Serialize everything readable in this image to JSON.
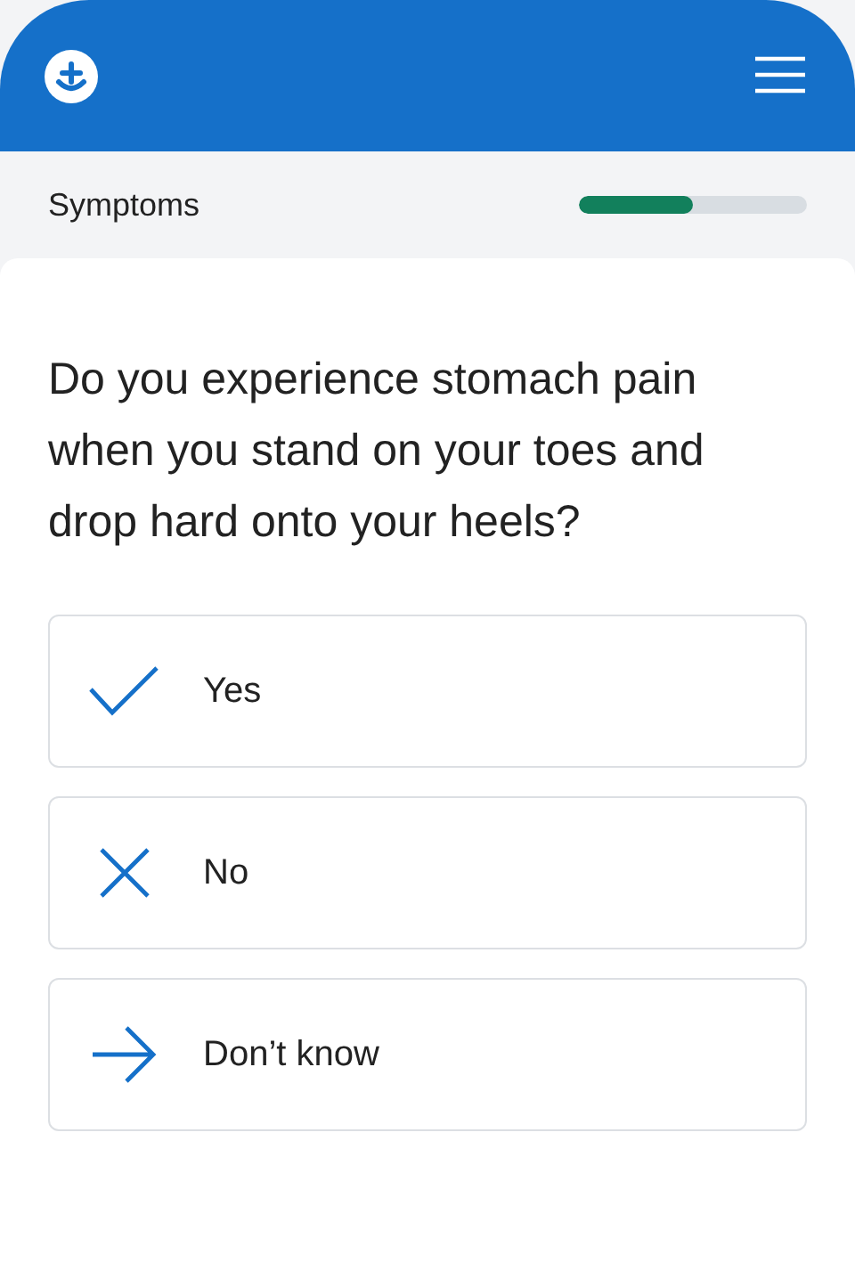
{
  "section": {
    "title": "Symptoms",
    "level": 0.5
  },
  "question": "Do you experience stomach pain when you stand on your toes and drop hard onto your heels?",
  "options": [
    {
      "kind": "check",
      "label": "Yes"
    },
    {
      "kind": "cross",
      "label": "No"
    },
    {
      "kind": "arrow",
      "label": "Don’t know"
    }
  ]
}
